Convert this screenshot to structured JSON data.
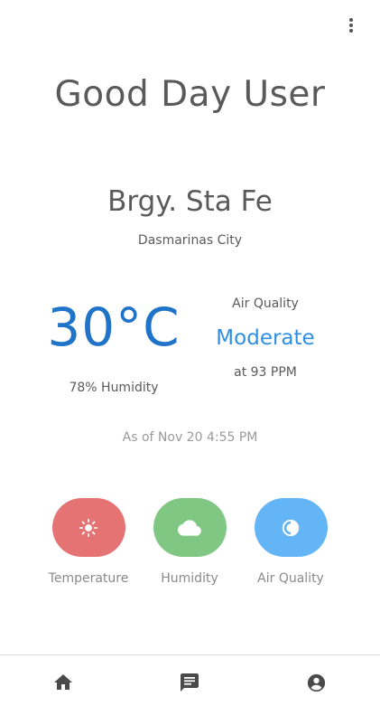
{
  "greeting": "Good Day User",
  "location": {
    "barangay": "Brgy. Sta Fe",
    "city": "Dasmarinas City"
  },
  "weather": {
    "temperature": "30°C",
    "humidity": "78% Humidity"
  },
  "air_quality": {
    "label": "Air Quality",
    "status": "Moderate",
    "reading": "at 93 PPM"
  },
  "timestamp": "As of Nov 20 4:55 PM",
  "actions": [
    {
      "label": "Temperature",
      "icon": "sun-icon",
      "color": "#e57373"
    },
    {
      "label": "Humidity",
      "icon": "cloud-icon",
      "color": "#81c784"
    },
    {
      "label": "Air Quality",
      "icon": "contrast-icon",
      "color": "#64b5f6"
    }
  ],
  "bottom_nav": [
    {
      "icon": "home-icon"
    },
    {
      "icon": "message-icon"
    },
    {
      "icon": "account-icon"
    }
  ],
  "colors": {
    "temperature_text": "#1f73c8",
    "air_quality_text": "#2f8fe3"
  }
}
